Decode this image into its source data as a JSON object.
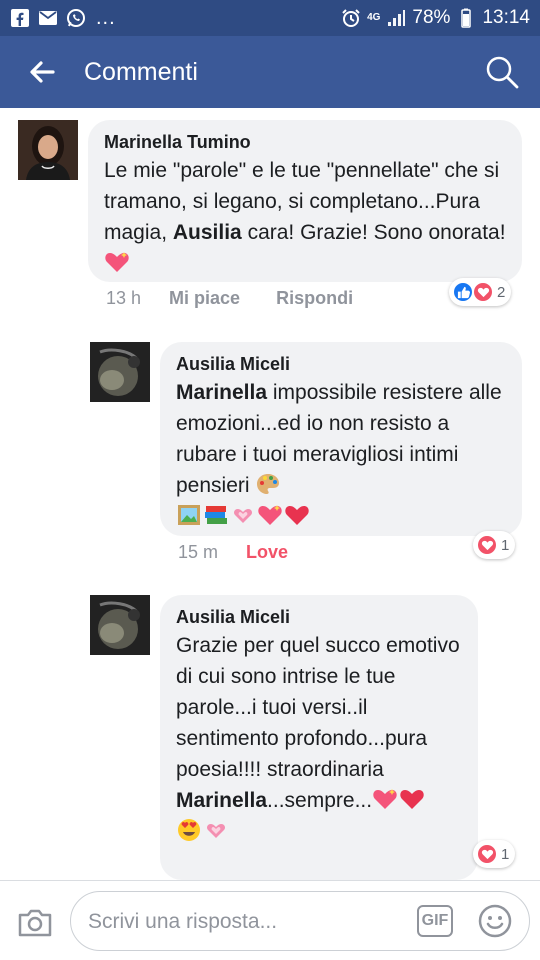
{
  "status_bar": {
    "dots": "...",
    "network": "4G",
    "battery": "78%",
    "time": "13:14"
  },
  "header": {
    "title": "Commenti"
  },
  "comments": [
    {
      "author": "Marinella Tumino",
      "text_parts": [
        "Le mie \"parole\" e le tue \"pennellate\" che si tramano, si legano, si completano...Pura magia, ",
        "Ausilia",
        " cara! Grazie! Sono onorata!"
      ],
      "emojis": [
        "sparkling-heart"
      ],
      "time": "13 h",
      "actions": [
        "Mi piace",
        "Rispondi"
      ],
      "reactions": [
        "like",
        "love"
      ],
      "reaction_count": "2"
    },
    {
      "author": "Ausilia Miceli",
      "text_parts": [
        "Marinella",
        " impossibile resistere alle emozioni...ed io non  resisto a rubare i tuoi meravigliosi intimi pensieri "
      ],
      "emojis": [
        "artist-palette",
        "framed-picture",
        "books",
        "sparkling-heart",
        "sparkling-heart",
        "red-heart"
      ],
      "time": "15 m",
      "actions": [
        "Love"
      ],
      "reactions": [
        "love"
      ],
      "reaction_count": "1"
    },
    {
      "author": "Ausilia Miceli",
      "text_parts": [
        "Grazie per quel succo emotivo di cui sono intrise le tue parole...i tuoi versi..il sentimento profondo...pura poesia!!!! straordinaria ",
        "Marinella",
        "...sempre..."
      ],
      "emojis": [
        "sparkling-heart",
        "red-heart",
        "heart-eyes",
        "sparkling-heart"
      ],
      "reactions": [
        "love"
      ],
      "reaction_count": "1"
    }
  ],
  "composer": {
    "placeholder": "Scrivi una risposta...",
    "gif_label": "GIF"
  },
  "colors": {
    "status_bar": "#2f4b83",
    "app_bar": "#3b5998",
    "bubble": "#f1f2f4",
    "love": "#f25268",
    "like": "#1877f2",
    "meta": "#90949c"
  }
}
